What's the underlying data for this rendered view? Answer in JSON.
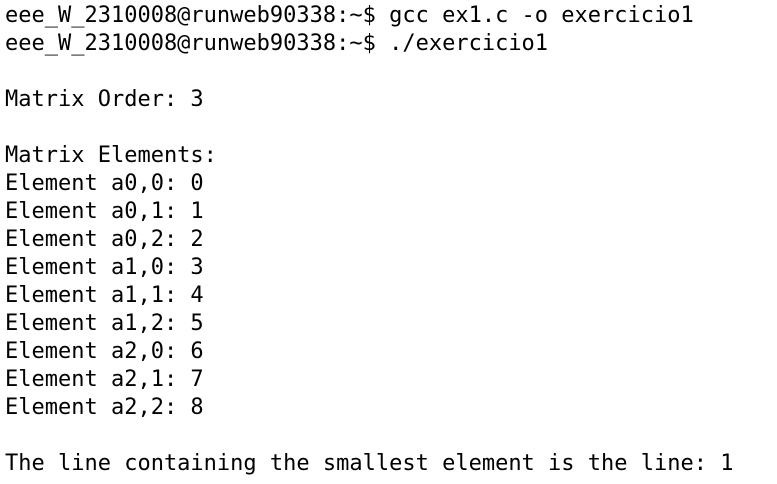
{
  "terminal": {
    "lines": [
      "eee_W_2310008@runweb90338:~$ gcc ex1.c -o exercicio1",
      "eee_W_2310008@runweb90338:~$ ./exercicio1",
      "",
      "Matrix Order: 3",
      "",
      "Matrix Elements:",
      "Element a0,0: 0",
      "Element a0,1: 1",
      "Element a0,2: 2",
      "Element a1,0: 3",
      "Element a1,1: 4",
      "Element a1,2: 5",
      "Element a2,0: 6",
      "Element a2,1: 7",
      "Element a2,2: 8",
      "",
      "The line containing the smallest element is the line: 1"
    ]
  }
}
